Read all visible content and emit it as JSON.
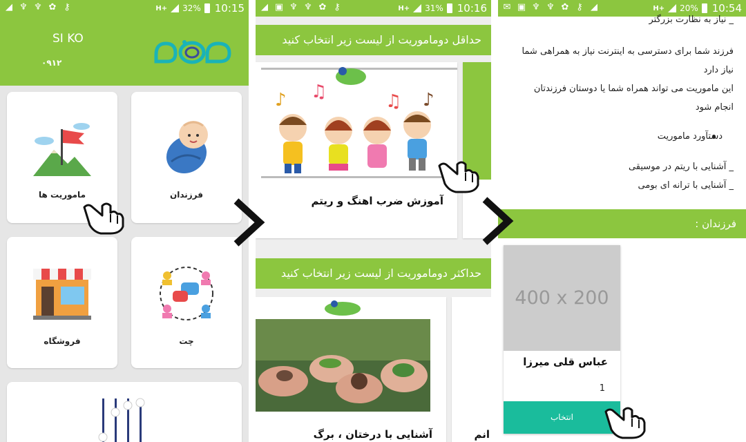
{
  "screens": [
    {
      "status": {
        "battery": "32%",
        "time": "10:15"
      },
      "user": {
        "name": "SI KO",
        "phone": "۰۹۱۲"
      },
      "tiles": [
        {
          "label": "ماموریت ها",
          "icon": "mountain-flag-icon"
        },
        {
          "label": "فرزندان",
          "icon": "baby-icon"
        },
        {
          "label": "فروشگاه",
          "icon": "store-icon"
        },
        {
          "label": "چت",
          "icon": "chat-icon"
        }
      ]
    },
    {
      "status": {
        "battery": "31%",
        "time": "10:16"
      },
      "sections": [
        {
          "title": "حداقل دوماموریت از لیست زیر انتخاب کنید",
          "card_title": "آموزش ضرب اهنگ و ریتم"
        },
        {
          "title": "حداکثر دوماموریت از لیست زیر انتخاب کنید",
          "card_title": "آشنایی با درختان ، برگ",
          "peek_title": "انم"
        }
      ]
    },
    {
      "status": {
        "battery": "20%",
        "time": "10:54"
      },
      "lines": [
        "_ نیاز به نظارت بزرگتر",
        "فرزند شما برای دسترسی به اینترنت نیاز به همراهی شما",
        "نیاز دارد",
        "این ماموریت می تواند همراه شما یا دوستان فرزندتان",
        "انجام شود"
      ],
      "bullet": "دستآورد ماموریت",
      "achievements": [
        "_ آشنایی با ریتم در موسیقی",
        "_ آشنایی با ترانه ای بومی"
      ],
      "kids_label": "فرزندان :",
      "child": {
        "placeholder": "400 x 200",
        "name": "عباس قلی میرزا",
        "number": "1",
        "select_label": "انتخاب"
      }
    }
  ],
  "colors": {
    "brand_green": "#8cc63f",
    "select_teal": "#1abc9c"
  }
}
